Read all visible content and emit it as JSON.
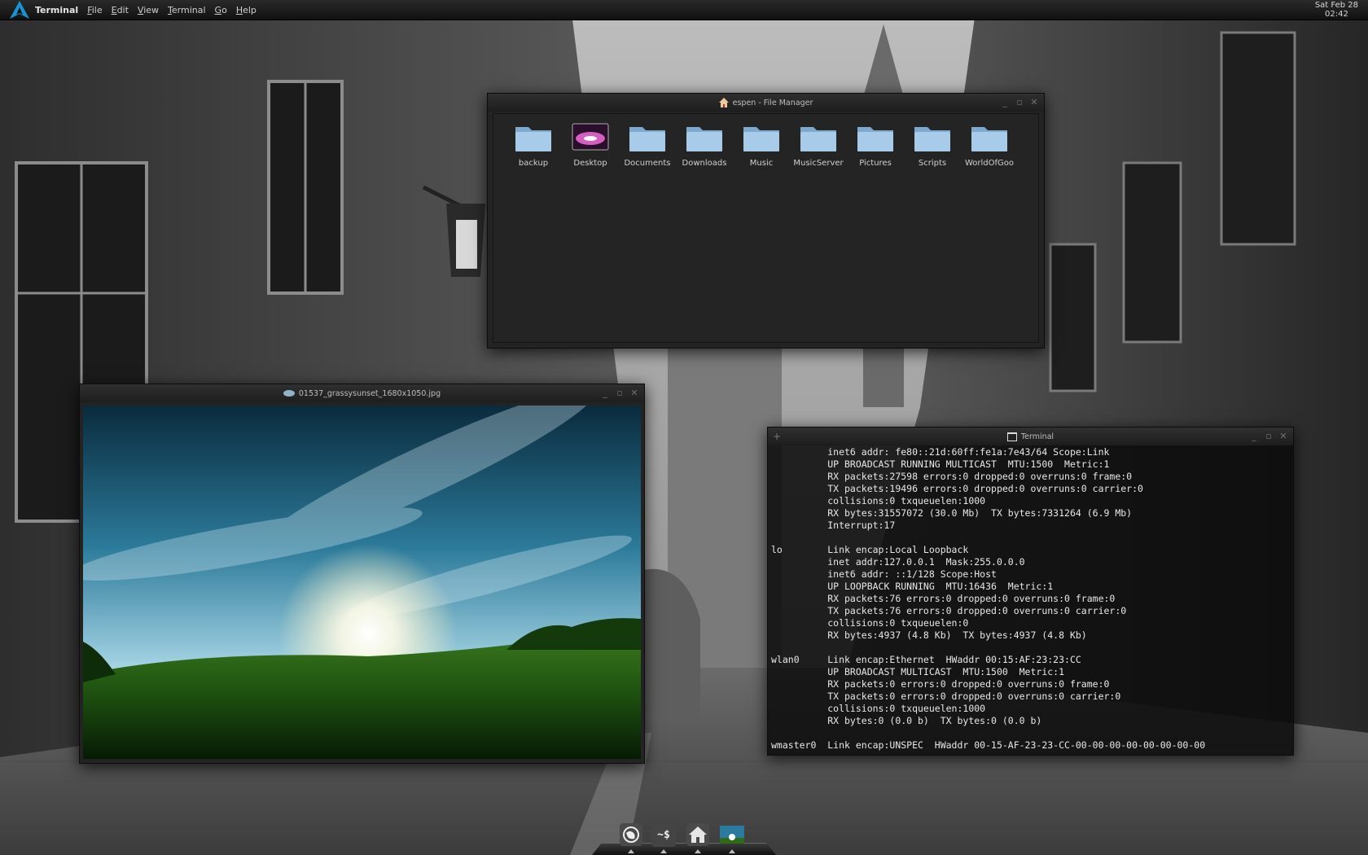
{
  "top_panel": {
    "app_name": "Terminal",
    "menu": [
      {
        "label": "File",
        "mnemonic": "F",
        "rest": "ile"
      },
      {
        "label": "Edit",
        "mnemonic": "E",
        "rest": "dit"
      },
      {
        "label": "View",
        "mnemonic": "V",
        "rest": "iew"
      },
      {
        "label": "Terminal",
        "mnemonic": "T",
        "rest": "erminal"
      },
      {
        "label": "Go",
        "mnemonic": "G",
        "rest": "o"
      },
      {
        "label": "Help",
        "mnemonic": "H",
        "rest": "elp"
      }
    ],
    "clock_date": "Sat Feb 28",
    "clock_time": "02:42"
  },
  "file_manager": {
    "title": "espen - File Manager",
    "items": [
      "backup",
      "Desktop",
      "Documents",
      "Downloads",
      "Music",
      "MusicServer",
      "Pictures",
      "Scripts",
      "WorldOfGoo"
    ]
  },
  "image_viewer": {
    "title": "01537_grassysunset_1680x1050.jpg"
  },
  "terminal": {
    "title": "Terminal",
    "lines": [
      "          inet6 addr: fe80::21d:60ff:fe1a:7e43/64 Scope:Link",
      "          UP BROADCAST RUNNING MULTICAST  MTU:1500  Metric:1",
      "          RX packets:27598 errors:0 dropped:0 overruns:0 frame:0",
      "          TX packets:19496 errors:0 dropped:0 overruns:0 carrier:0",
      "          collisions:0 txqueuelen:1000",
      "          RX bytes:31557072 (30.0 Mb)  TX bytes:7331264 (6.9 Mb)",
      "          Interrupt:17",
      "",
      "lo        Link encap:Local Loopback",
      "          inet addr:127.0.0.1  Mask:255.0.0.0",
      "          inet6 addr: ::1/128 Scope:Host",
      "          UP LOOPBACK RUNNING  MTU:16436  Metric:1",
      "          RX packets:76 errors:0 dropped:0 overruns:0 frame:0",
      "          TX packets:76 errors:0 dropped:0 overruns:0 carrier:0",
      "          collisions:0 txqueuelen:0",
      "          RX bytes:4937 (4.8 Kb)  TX bytes:4937 (4.8 Kb)",
      "",
      "wlan0     Link encap:Ethernet  HWaddr 00:15:AF:23:23:CC",
      "          UP BROADCAST MULTICAST  MTU:1500  Metric:1",
      "          RX packets:0 errors:0 dropped:0 overruns:0 frame:0",
      "          TX packets:0 errors:0 dropped:0 overruns:0 carrier:0",
      "          collisions:0 txqueuelen:1000",
      "          RX bytes:0 (0.0 b)  TX bytes:0 (0.0 b)",
      "",
      "wmaster0  Link encap:UNSPEC  HWaddr 00-15-AF-23-23-CC-00-00-00-00-00-00-00-00"
    ]
  },
  "dock": {
    "items": [
      {
        "name": "web-browser",
        "icon": "globe-icon"
      },
      {
        "name": "terminal",
        "icon": "terminal-prompt-icon",
        "glyph": "~$"
      },
      {
        "name": "file-manager",
        "icon": "home-icon"
      },
      {
        "name": "image-viewer",
        "icon": "landscape-thumbnail-icon"
      }
    ]
  }
}
